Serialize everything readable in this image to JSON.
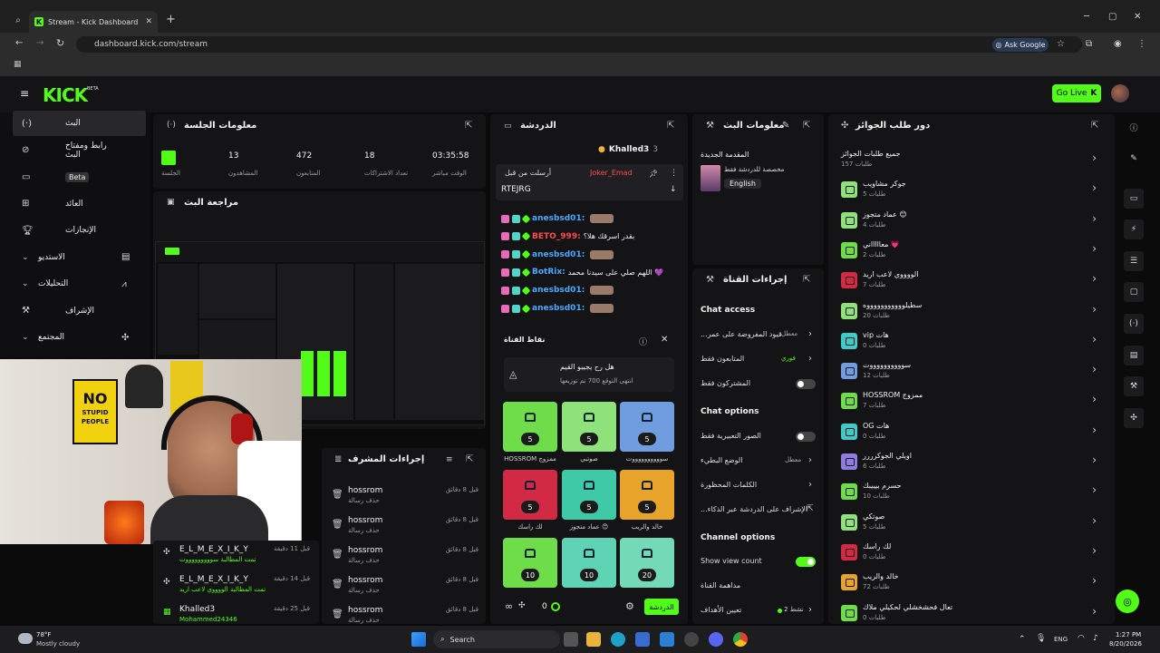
{
  "browser": {
    "tab_title": "Stream - Kick Dashboard",
    "url": "dashboard.kick.com/stream",
    "ask_google": "Ask Google",
    "new_tab": "+"
  },
  "header": {
    "logo": "KICK",
    "beta": "BETA",
    "go_live": "Go Live"
  },
  "sidebar": {
    "items": [
      {
        "label": "البث",
        "icon": "broadcast-icon"
      },
      {
        "label": "رابط ومفتاح البث",
        "icon": "link-icon"
      },
      {
        "label": "الإعلان",
        "badge": "Beta",
        "icon": "ad-icon"
      },
      {
        "label": "العائد",
        "icon": "revenue-icon"
      },
      {
        "label": "الإنجازات",
        "icon": "trophy-icon"
      },
      {
        "label": "الاستديو",
        "icon": "studio-icon"
      },
      {
        "label": "التحليلات",
        "icon": "analytics-icon"
      },
      {
        "label": "الإشراف",
        "icon": "moderation-icon"
      },
      {
        "label": "المجتمع",
        "icon": "community-icon"
      }
    ]
  },
  "session": {
    "title": "معلومات الجلسة",
    "stats": [
      {
        "value": "03:35:58",
        "label": "الوقت مباشر"
      },
      {
        "value": "18",
        "label": "تعداد الاشتراكات"
      },
      {
        "value": "472",
        "label": "المتابعون"
      },
      {
        "value": "13",
        "label": "المشاهدون"
      },
      {
        "value": "",
        "label": "الجلسة"
      }
    ]
  },
  "preview": {
    "title": "مراجعة البث"
  },
  "mod_actions": {
    "title": "إجراءات المشرف",
    "rows": [
      {
        "name": "hossrom",
        "sub": "حذف رسالة",
        "time": "قبل 8 دقائق"
      },
      {
        "name": "hossrom",
        "sub": "حذف رسالة",
        "time": "قبل 8 دقائق"
      },
      {
        "name": "hossrom",
        "sub": "حذف رسالة",
        "time": "قبل 8 دقائق"
      },
      {
        "name": "hossrom",
        "sub": "حذف رسالة",
        "time": "قبل 8 دقائق"
      },
      {
        "name": "hossrom",
        "sub": "حذف رسالة",
        "time": "قبل 8 دقائق"
      }
    ]
  },
  "activity": {
    "rows": [
      {
        "name": "E_L_M_E_X_I_K_Y",
        "sub": "تمت المطالبة سوووووووووت",
        "time": "قبل 11 دقيقة"
      },
      {
        "name": "E_L_M_E_X_I_K_Y",
        "sub": "تمت المطالبة الووووي لاعب اريد",
        "time": "قبل 14 دقيقة"
      },
      {
        "name": "Khalled3",
        "sub": "Mohammed24346",
        "time": "قبل 25 دقيقة"
      }
    ]
  },
  "chat": {
    "title": "الدردشة",
    "top_user": "Khalled3",
    "top_count": "3",
    "pinned_user": "Joker_Emad",
    "pinned_label": "أرسلت من قبل",
    "pinned_message": "RTEJRG",
    "messages": [
      {
        "user": "anesbsd01:",
        "color": "#4aa8ff",
        "text": ""
      },
      {
        "user": "BETO_999:",
        "color": "#ff4d4d",
        "text": "بقدر اسرقك هلا؟"
      },
      {
        "user": "anesbsd01:",
        "color": "#4aa8ff",
        "text": ""
      },
      {
        "user": "BotRix:",
        "color": "#4aa8ff",
        "text": "اللهم صلي على سيدنا محمد 💜"
      },
      {
        "user": "anesbsd01:",
        "color": "#4aa8ff",
        "text": ""
      },
      {
        "user": "anesbsd01:",
        "color": "#4aa8ff",
        "text": ""
      }
    ],
    "send_label": "الدردشة",
    "points": "0"
  },
  "channel_points": {
    "title": "نقاط القناة",
    "prediction_title": "هل رح يجيبو القيم",
    "prediction_sub": "انتهى التوقع 700 تم توزيعها",
    "tiles": [
      {
        "value": "5",
        "color": "#6fdd4a",
        "label": "HOSSROM ممزوج"
      },
      {
        "value": "5",
        "color": "#8fe27a",
        "label": "صوتبي"
      },
      {
        "value": "5",
        "color": "#6f9de0",
        "label": "سووووووووووت"
      },
      {
        "value": "5",
        "color": "#d22a45",
        "label": "لك راسك"
      },
      {
        "value": "5",
        "color": "#3fc9a6",
        "label": "عماد متجوز 😊"
      },
      {
        "value": "5",
        "color": "#e8a32b",
        "label": "خالد والريب"
      },
      {
        "value": "10",
        "color": "#6fdd4a",
        "label": ""
      },
      {
        "value": "10",
        "color": "#5fd4b5",
        "label": ""
      },
      {
        "value": "20",
        "color": "#73d9b6",
        "label": ""
      }
    ]
  },
  "stream_info": {
    "title": "معلومات البث",
    "stream_title": "المقدمة الجديدة",
    "category": "مخصصة للدردشة فقط",
    "language": "English"
  },
  "channel_actions": {
    "title": "إجراءات القناة",
    "chat_access": "Chat access",
    "rows_access": [
      {
        "label": "...قيود المفروضة على عمر",
        "value": "معطل"
      },
      {
        "label": "المتابعون فقط",
        "value": "فوري"
      },
      {
        "label": "المشتركون فقط",
        "value": ""
      }
    ],
    "chat_options": "Chat options",
    "rows_options": [
      {
        "label": "الصور التعبيرية فقط",
        "value": ""
      },
      {
        "label": "الوضع البطيء",
        "value": "معطل"
      },
      {
        "label": "الكلمات المحظورة",
        "value": ""
      },
      {
        "label": "...الإشراف على الدردشة عبر الذكاء",
        "value": ""
      }
    ],
    "channel_options": "Channel options",
    "show_view_count": "Show view count",
    "raid": "مداهمة القناة",
    "goals": "تعيين الأهداف",
    "goals_value": "نشط 2"
  },
  "redemptions": {
    "title": "دور طلب الجوائز",
    "rows": [
      {
        "name": "جميع طلبات الجوائز",
        "count": "157 طلبات",
        "color": ""
      },
      {
        "name": "جوكر مشاويب",
        "count": "5 طلبات",
        "color": "#8fe27a"
      },
      {
        "name": "عماد متجوز 😊",
        "count": "4 طلبات",
        "color": "#8fe27a"
      },
      {
        "name": "معاااااني 💗",
        "count": "2 طلبات",
        "color": "#6fdd4a"
      },
      {
        "name": "الووووي لاعب اريد",
        "count": "7 طلبات",
        "color": "#d22a45"
      },
      {
        "name": "سطيلوووووووووووه",
        "count": "20 طلبات",
        "color": "#8fe27a"
      },
      {
        "name": "vip هات",
        "count": "0 طلبات",
        "color": "#3fc9c9"
      },
      {
        "name": "سووووووووووت",
        "count": "12 طلبات",
        "color": "#6f9de0"
      },
      {
        "name": "HOSSROM ممزوج",
        "count": "7 طلبات",
        "color": "#6fdd4a"
      },
      {
        "name": "OG هات",
        "count": "0 طلبات",
        "color": "#3fc9c9"
      },
      {
        "name": "اويلي الجوكرررر",
        "count": "6 طلبات",
        "color": "#8f7ce0"
      },
      {
        "name": "حسرم بيييبك",
        "count": "10 طلبات",
        "color": "#6fdd4a"
      },
      {
        "name": "صوتكي",
        "count": "5 طلبات",
        "color": "#8fe27a"
      },
      {
        "name": "لك راسك",
        "count": "0 طلبات",
        "color": "#d22a45"
      },
      {
        "name": "خالد والريب",
        "count": "72 طلبات",
        "color": "#e8a32b"
      },
      {
        "name": "تعال فحشخشلي لحكيلي ملاك",
        "count": "0 طلبات",
        "color": "#6fdd4a"
      }
    ]
  },
  "taskbar": {
    "temp": "78°F",
    "weather": "Mostly cloudy",
    "search": "Search",
    "lang": "ENG",
    "time": "1:27 PM",
    "date": "8/20/2026"
  },
  "colors": {
    "accent": "#53fc18",
    "bg": "#0b0b0c",
    "panel": "#141416"
  }
}
